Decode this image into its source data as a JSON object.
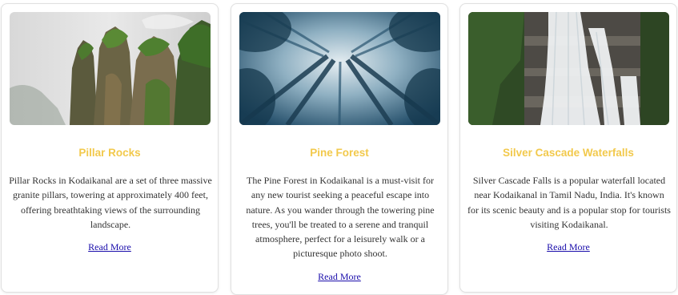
{
  "cards": [
    {
      "title": "Pillar Rocks",
      "description": "Pillar Rocks in Kodaikanal are a set of three massive granite pillars, towering at approximately 400 feet, offering breathtaking views of the surrounding landscape.",
      "link_label": "Read More"
    },
    {
      "title": "Pine Forest",
      "description": "The Pine Forest in Kodaikanal is a must-visit for any new tourist seeking a peaceful escape into nature. As you wander through the towering pine trees, you'll be treated to a serene and tranquil atmosphere, perfect for a leisurely walk or a picturesque photo shoot.",
      "link_label": "Read More"
    },
    {
      "title": "Silver Cascade Waterfalls",
      "description": "Silver Cascade Falls is a popular waterfall located near Kodaikanal in Tamil Nadu, India. It's known for its scenic beauty and is a popular stop for tourists visiting Kodaikanal.",
      "link_label": "Read More"
    }
  ],
  "colors": {
    "title": "#f2c94c",
    "link": "#1a0dab",
    "card_border": "#e0e0e0"
  }
}
